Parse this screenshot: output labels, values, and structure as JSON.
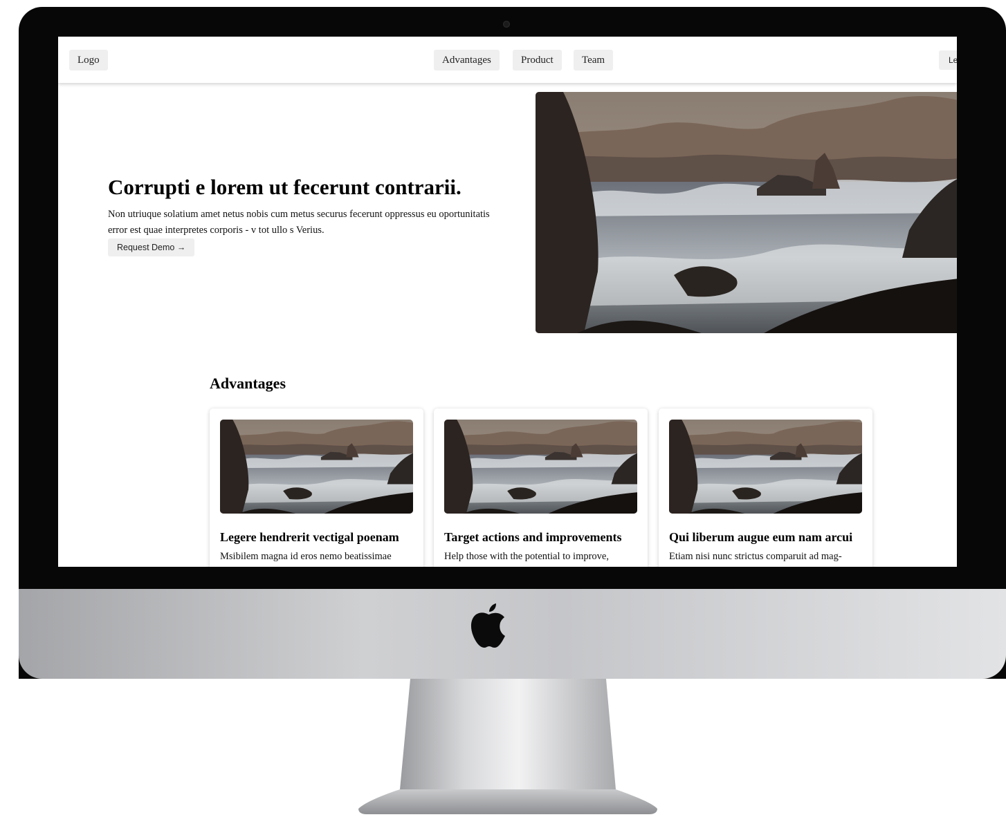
{
  "nav": {
    "logo": "Logo",
    "links": [
      "Advantages",
      "Product",
      "Team"
    ],
    "right_label": "Le"
  },
  "hero": {
    "title": "Corrupti e lorem ut fecerunt contrarii.",
    "text_line1": "Non utriuque solatium amet netus nobis cum metus securus fecerunt oppressus eu oportunitatis",
    "text_line2": "error est quae interpretes corporis - v tot ullo s Verius.",
    "cta_label": "Request Demo",
    "cta_arrow": "→",
    "image": "ocean-waves-rocks-photo"
  },
  "advantages": {
    "title": "Advantages",
    "cards": [
      {
        "title": "Legere hendrerit vectigal poenam",
        "text": "Msibilem magna id eros nemo beatissimae"
      },
      {
        "title": "Target actions and improvements",
        "text": "Help those with the potential to improve,"
      },
      {
        "title": "Qui liberum augue eum nam arcui",
        "text": "Etiam nisi nunc strictus comparuit ad mag-"
      }
    ]
  },
  "device": {
    "type": "imac",
    "brand_icon": "apple-logo-icon"
  }
}
